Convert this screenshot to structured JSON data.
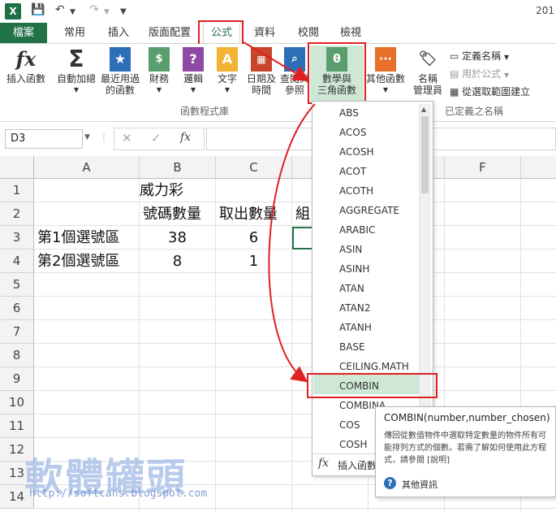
{
  "window": {
    "title_fragment": "201"
  },
  "tabs": [
    {
      "label": "檔案"
    },
    {
      "label": "常用"
    },
    {
      "label": "插入"
    },
    {
      "label": "版面配置"
    },
    {
      "label": "公式"
    },
    {
      "label": "資料"
    },
    {
      "label": "校閱"
    },
    {
      "label": "檢視"
    }
  ],
  "ribbon": {
    "insert_function": "插入函數",
    "autosum": "自動加總",
    "recent_line1": "最近用過",
    "recent_line2": "的函數",
    "financial": "財務",
    "logical": "邏輯",
    "text": "文字",
    "datetime_line1": "日期及",
    "datetime_line2": "時間",
    "lookup_line1": "查閱與",
    "lookup_line2": "參照",
    "math_line1": "數學與",
    "math_line2": "三角函數",
    "more": "其他函數",
    "name_manager_line1": "名稱",
    "name_manager_line2": "管理員",
    "define_name": "定義名稱",
    "use_in_formula": "用於公式",
    "create_from_selection": "從選取範圍建立",
    "group_function_library": "函數程式庫",
    "group_defined_names": "已定義之名稱"
  },
  "formula_bar": {
    "name_box": "D3",
    "fx": "fx"
  },
  "sheet": {
    "columns": [
      "A",
      "B",
      "C",
      "D",
      "E",
      "F"
    ],
    "rows": [
      "1",
      "2",
      "3",
      "4",
      "5",
      "6",
      "7",
      "8",
      "9",
      "10",
      "11",
      "12",
      "13",
      "14"
    ],
    "cells": {
      "B1": "威力彩",
      "B2": "號碼數量",
      "C2": "取出數量",
      "D2": "組",
      "A3": "第1個選號區",
      "B3": "38",
      "C3": "6",
      "A4": "第2個選號區",
      "B4": "8",
      "C4": "1"
    }
  },
  "dropdown": {
    "functions": [
      "ABS",
      "ACOS",
      "ACOSH",
      "ACOT",
      "ACOTH",
      "AGGREGATE",
      "ARABIC",
      "ASIN",
      "ASINH",
      "ATAN",
      "ATAN2",
      "ATANH",
      "BASE",
      "CEILING.MATH",
      "COMBIN",
      "COMBINA",
      "COS",
      "COSH"
    ],
    "selected": "COMBIN",
    "insert_function_label": "插入函數"
  },
  "tooltip": {
    "signature": "COMBIN(number,number_chosen)",
    "description": "傳回從數值物件中選取特定數量的物件所有可能排列方式的個數。若需了解如何使用此方程式，請參閱 [說明]",
    "more_info": "其他資訊"
  },
  "watermark": {
    "text": "軟體罐頭",
    "url": "http://softcans.blogspot.com"
  },
  "colors": {
    "excel_green": "#217346",
    "highlight_red": "#e02020",
    "selected_fn_bg": "#cfe8d6"
  }
}
